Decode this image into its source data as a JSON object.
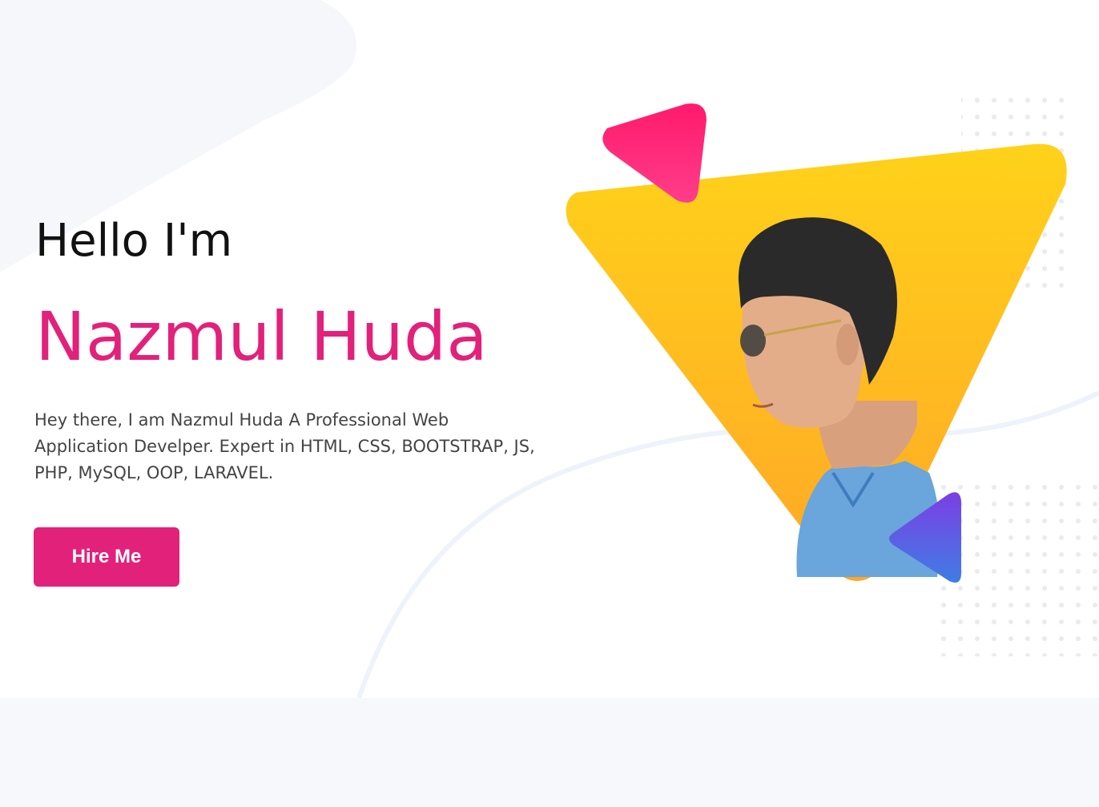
{
  "hero": {
    "greeting": "Hello I'm",
    "name": "Nazmul Huda",
    "bio": "Hey there, I am Nazmul Huda A Professional Web Application Develper. Expert in HTML, CSS, BOOTSTRAP, JS, PHP, MySQL, OOP, LARAVEL.",
    "cta_label": "Hire Me"
  },
  "colors": {
    "accent": "#e2217a",
    "yellow": "#ffc61a",
    "purple": "#7b3fe4",
    "background_alt": "#f7f8fc"
  },
  "icons": [
    "profile-photo",
    "pink-triangle-shape",
    "purple-triangle-shape",
    "dot-pattern"
  ]
}
